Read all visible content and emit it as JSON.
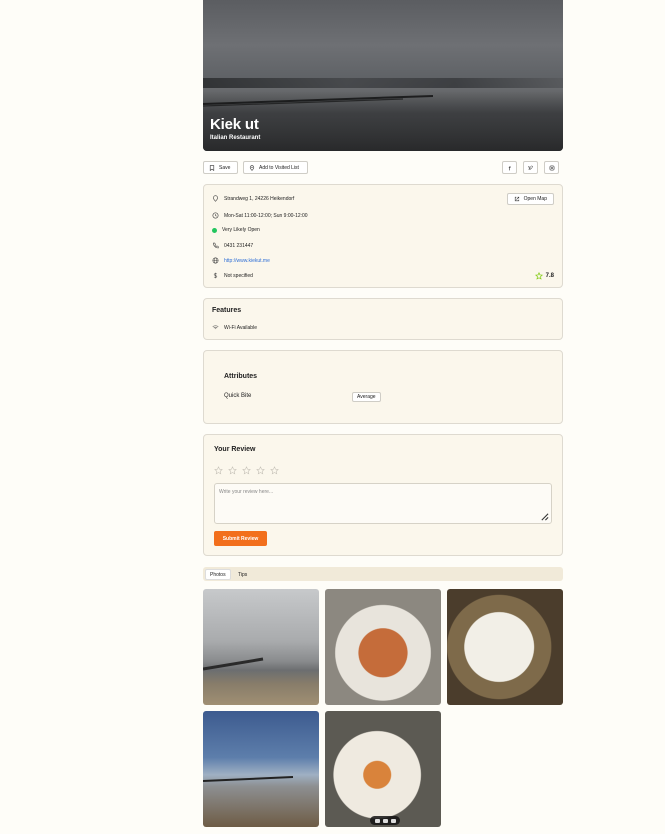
{
  "hero": {
    "name": "Kiek ut",
    "category": "Italian Restaurant"
  },
  "actions": {
    "save_label": "Save",
    "visited_label": "Add to Visited List"
  },
  "social": [
    "facebook-icon",
    "twitter-icon",
    "instagram-icon"
  ],
  "info": {
    "address": "Strandweg 1, 24226 Heikendorf",
    "hours": "Mon-Sat 11:00-12:00; Sun 9:00-12:00",
    "open_status": "Very Likely Open",
    "phone": "0431 231447",
    "website": "http://www.kiekut.me",
    "price": "Not specified",
    "rating": "7.8",
    "open_map_label": "Open Map"
  },
  "features": {
    "title": "Features",
    "items": [
      "Wi-Fi Available"
    ]
  },
  "attributes": {
    "title": "Attributes",
    "items": [
      {
        "label": "Quick Bite",
        "value": "Average"
      }
    ]
  },
  "review": {
    "title": "Your Review",
    "placeholder": "Write your review here...",
    "submit_label": "Submit Review",
    "stars": 5
  },
  "tabs": [
    {
      "label": "Photos",
      "active": true
    },
    {
      "label": "Tips",
      "active": false
    }
  ],
  "colors": {
    "accent": "#f26f1c",
    "open_dot": "#22c55e",
    "link": "#2f6fd6",
    "rating_star": "#84cc16"
  }
}
